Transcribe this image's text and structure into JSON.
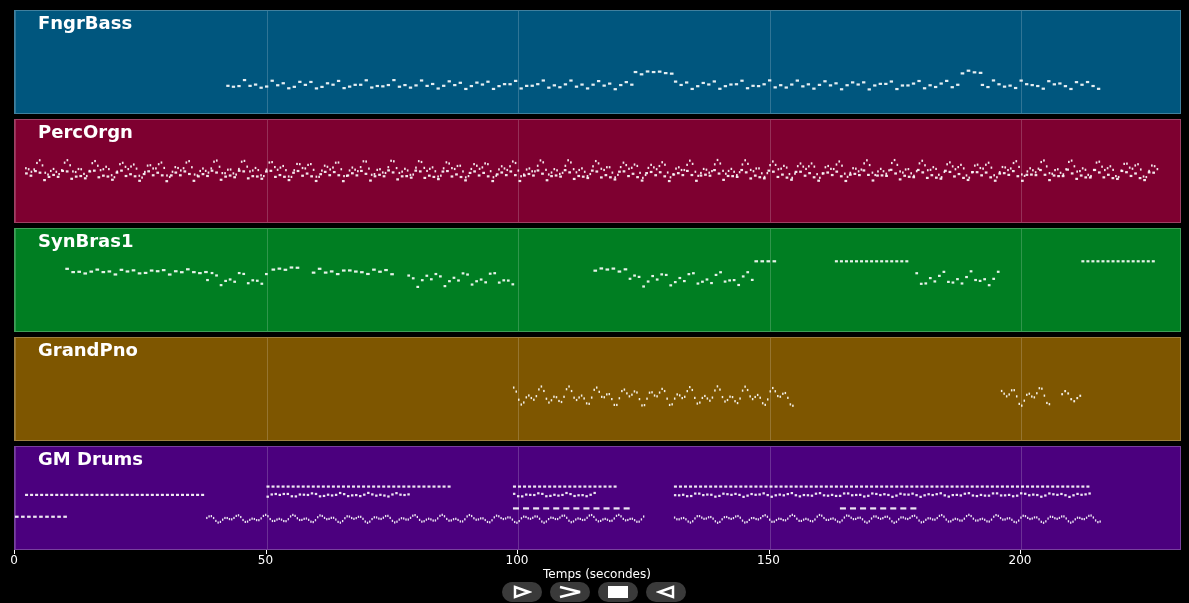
{
  "tracks": [
    {
      "name": "FngrBass",
      "color": "#00567e"
    },
    {
      "name": "PercOrgn",
      "color": "#7e0030"
    },
    {
      "name": "SynBras1",
      "color": "#007e22"
    },
    {
      "name": "GrandPno",
      "color": "#7e5600"
    },
    {
      "name": "GM Drums",
      "color": "#4b007e"
    }
  ],
  "x_axis": {
    "ticks": [
      "0",
      "50",
      "100",
      "150",
      "200"
    ],
    "label": "Temps (secondes)"
  }
}
